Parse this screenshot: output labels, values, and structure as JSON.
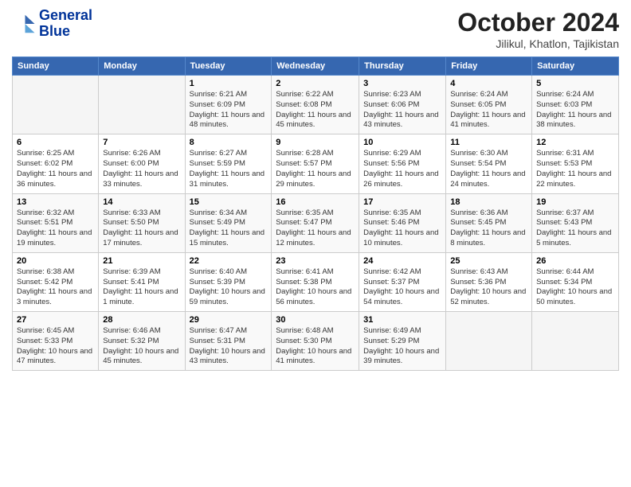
{
  "logo": {
    "line1": "General",
    "line2": "Blue"
  },
  "title": "October 2024",
  "subtitle": "Jilikul, Khatlon, Tajikistan",
  "weekdays": [
    "Sunday",
    "Monday",
    "Tuesday",
    "Wednesday",
    "Thursday",
    "Friday",
    "Saturday"
  ],
  "weeks": [
    [
      {
        "day": "",
        "info": ""
      },
      {
        "day": "",
        "info": ""
      },
      {
        "day": "1",
        "info": "Sunrise: 6:21 AM\nSunset: 6:09 PM\nDaylight: 11 hours and 48 minutes."
      },
      {
        "day": "2",
        "info": "Sunrise: 6:22 AM\nSunset: 6:08 PM\nDaylight: 11 hours and 45 minutes."
      },
      {
        "day": "3",
        "info": "Sunrise: 6:23 AM\nSunset: 6:06 PM\nDaylight: 11 hours and 43 minutes."
      },
      {
        "day": "4",
        "info": "Sunrise: 6:24 AM\nSunset: 6:05 PM\nDaylight: 11 hours and 41 minutes."
      },
      {
        "day": "5",
        "info": "Sunrise: 6:24 AM\nSunset: 6:03 PM\nDaylight: 11 hours and 38 minutes."
      }
    ],
    [
      {
        "day": "6",
        "info": "Sunrise: 6:25 AM\nSunset: 6:02 PM\nDaylight: 11 hours and 36 minutes."
      },
      {
        "day": "7",
        "info": "Sunrise: 6:26 AM\nSunset: 6:00 PM\nDaylight: 11 hours and 33 minutes."
      },
      {
        "day": "8",
        "info": "Sunrise: 6:27 AM\nSunset: 5:59 PM\nDaylight: 11 hours and 31 minutes."
      },
      {
        "day": "9",
        "info": "Sunrise: 6:28 AM\nSunset: 5:57 PM\nDaylight: 11 hours and 29 minutes."
      },
      {
        "day": "10",
        "info": "Sunrise: 6:29 AM\nSunset: 5:56 PM\nDaylight: 11 hours and 26 minutes."
      },
      {
        "day": "11",
        "info": "Sunrise: 6:30 AM\nSunset: 5:54 PM\nDaylight: 11 hours and 24 minutes."
      },
      {
        "day": "12",
        "info": "Sunrise: 6:31 AM\nSunset: 5:53 PM\nDaylight: 11 hours and 22 minutes."
      }
    ],
    [
      {
        "day": "13",
        "info": "Sunrise: 6:32 AM\nSunset: 5:51 PM\nDaylight: 11 hours and 19 minutes."
      },
      {
        "day": "14",
        "info": "Sunrise: 6:33 AM\nSunset: 5:50 PM\nDaylight: 11 hours and 17 minutes."
      },
      {
        "day": "15",
        "info": "Sunrise: 6:34 AM\nSunset: 5:49 PM\nDaylight: 11 hours and 15 minutes."
      },
      {
        "day": "16",
        "info": "Sunrise: 6:35 AM\nSunset: 5:47 PM\nDaylight: 11 hours and 12 minutes."
      },
      {
        "day": "17",
        "info": "Sunrise: 6:35 AM\nSunset: 5:46 PM\nDaylight: 11 hours and 10 minutes."
      },
      {
        "day": "18",
        "info": "Sunrise: 6:36 AM\nSunset: 5:45 PM\nDaylight: 11 hours and 8 minutes."
      },
      {
        "day": "19",
        "info": "Sunrise: 6:37 AM\nSunset: 5:43 PM\nDaylight: 11 hours and 5 minutes."
      }
    ],
    [
      {
        "day": "20",
        "info": "Sunrise: 6:38 AM\nSunset: 5:42 PM\nDaylight: 11 hours and 3 minutes."
      },
      {
        "day": "21",
        "info": "Sunrise: 6:39 AM\nSunset: 5:41 PM\nDaylight: 11 hours and 1 minute."
      },
      {
        "day": "22",
        "info": "Sunrise: 6:40 AM\nSunset: 5:39 PM\nDaylight: 10 hours and 59 minutes."
      },
      {
        "day": "23",
        "info": "Sunrise: 6:41 AM\nSunset: 5:38 PM\nDaylight: 10 hours and 56 minutes."
      },
      {
        "day": "24",
        "info": "Sunrise: 6:42 AM\nSunset: 5:37 PM\nDaylight: 10 hours and 54 minutes."
      },
      {
        "day": "25",
        "info": "Sunrise: 6:43 AM\nSunset: 5:36 PM\nDaylight: 10 hours and 52 minutes."
      },
      {
        "day": "26",
        "info": "Sunrise: 6:44 AM\nSunset: 5:34 PM\nDaylight: 10 hours and 50 minutes."
      }
    ],
    [
      {
        "day": "27",
        "info": "Sunrise: 6:45 AM\nSunset: 5:33 PM\nDaylight: 10 hours and 47 minutes."
      },
      {
        "day": "28",
        "info": "Sunrise: 6:46 AM\nSunset: 5:32 PM\nDaylight: 10 hours and 45 minutes."
      },
      {
        "day": "29",
        "info": "Sunrise: 6:47 AM\nSunset: 5:31 PM\nDaylight: 10 hours and 43 minutes."
      },
      {
        "day": "30",
        "info": "Sunrise: 6:48 AM\nSunset: 5:30 PM\nDaylight: 10 hours and 41 minutes."
      },
      {
        "day": "31",
        "info": "Sunrise: 6:49 AM\nSunset: 5:29 PM\nDaylight: 10 hours and 39 minutes."
      },
      {
        "day": "",
        "info": ""
      },
      {
        "day": "",
        "info": ""
      }
    ]
  ]
}
